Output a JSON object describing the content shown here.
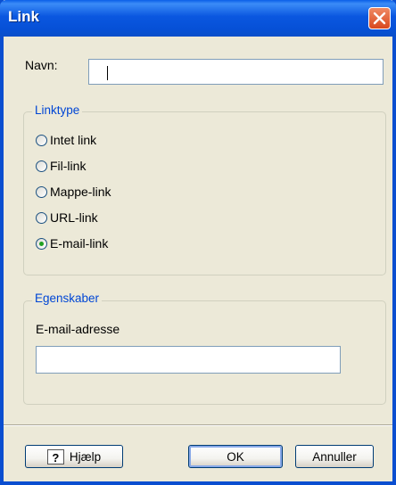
{
  "window": {
    "title": "Link"
  },
  "name_field": {
    "label": "Navn:",
    "value": ""
  },
  "linktype": {
    "legend": "Linktype",
    "options": [
      {
        "label": "Intet link",
        "checked": false
      },
      {
        "label": "Fil-link",
        "checked": false
      },
      {
        "label": "Mappe-link",
        "checked": false
      },
      {
        "label": "URL-link",
        "checked": false
      },
      {
        "label": "E-mail-link",
        "checked": true
      }
    ]
  },
  "properties": {
    "legend": "Egenskaber",
    "email_label": "E-mail-adresse",
    "email_value": ""
  },
  "buttons": {
    "help": "Hjælp",
    "ok": "OK",
    "cancel": "Annuller"
  },
  "icons": {
    "close": "close-icon",
    "help": "help-icon"
  },
  "colors": {
    "titlebar": "#0a57e0",
    "legend_text": "#0046d5",
    "dialog_bg": "#ece9d8"
  }
}
